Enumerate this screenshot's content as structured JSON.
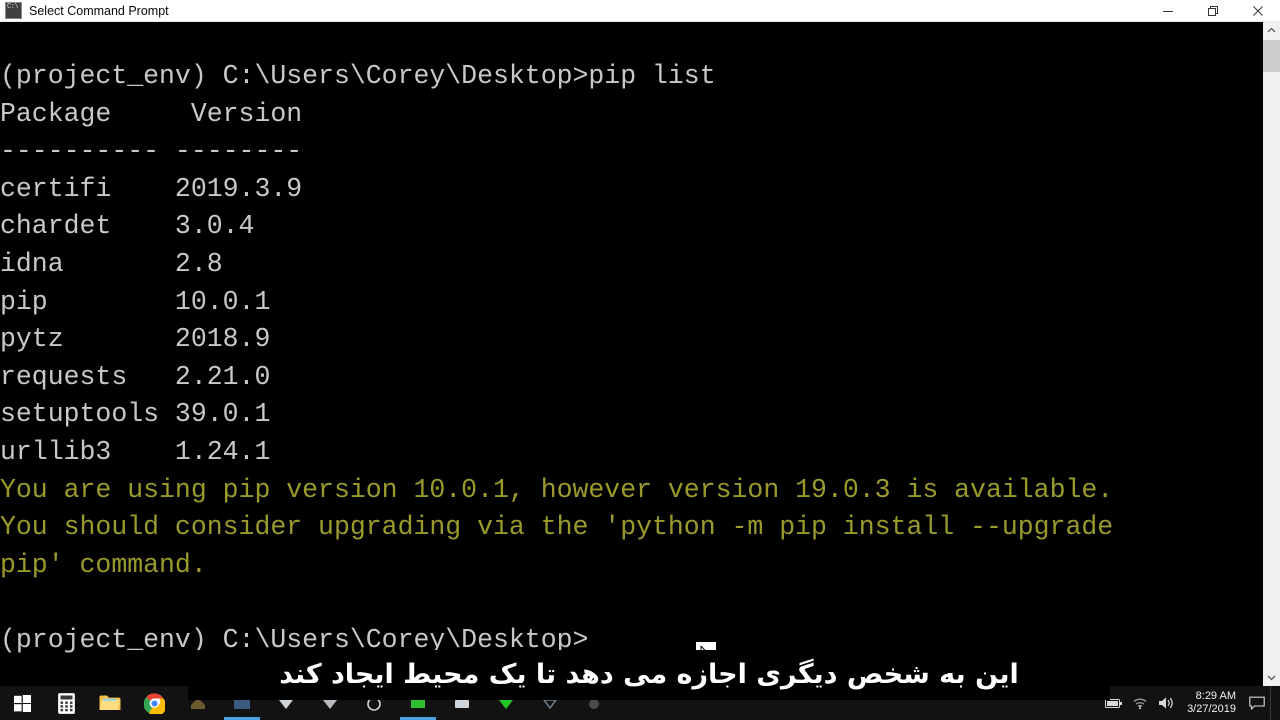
{
  "window": {
    "title": "Select Command Prompt",
    "icon": "command-prompt-icon",
    "controls": {
      "minimize": "minimize-icon",
      "restore": "restore-icon",
      "close": "close-icon"
    }
  },
  "console": {
    "background": "#000000",
    "foreground": "#c8c8c8",
    "warning_color": "#9a9a2c",
    "lines": [
      {
        "text": "(project_env) C:\\Users\\Corey\\Desktop>pip list",
        "style": "normal"
      },
      {
        "text": "Package     Version",
        "style": "normal"
      },
      {
        "text": "---------- --------",
        "style": "normal"
      },
      {
        "text": "certifi    2019.3.9",
        "style": "normal"
      },
      {
        "text": "chardet    3.0.4",
        "style": "normal"
      },
      {
        "text": "idna       2.8",
        "style": "normal"
      },
      {
        "text": "pip        10.0.1",
        "style": "normal"
      },
      {
        "text": "pytz       2018.9",
        "style": "normal"
      },
      {
        "text": "requests   2.21.0",
        "style": "normal"
      },
      {
        "text": "setuptools 39.0.1",
        "style": "normal"
      },
      {
        "text": "urllib3    1.24.1",
        "style": "normal"
      },
      {
        "text": "You are using pip version 10.0.1, however version 19.0.3 is available.",
        "style": "warn"
      },
      {
        "text": "You should consider upgrading via the 'python -m pip install --upgrade",
        "style": "warn"
      },
      {
        "text": "pip' command.",
        "style": "warn"
      },
      {
        "text": "",
        "style": "normal"
      },
      {
        "text": "(project_env) C:\\Users\\Corey\\Desktop>",
        "style": "normal"
      }
    ]
  },
  "subtitle": {
    "text": "این به شخص دیگری اجازه می دهد تا یک محیط ایجاد کند"
  },
  "taskbar": {
    "items": [
      {
        "name": "start-button",
        "icon": "windows-logo-icon",
        "active": false
      },
      {
        "name": "calculator",
        "icon": "calculator-icon",
        "active": false
      },
      {
        "name": "file-explorer",
        "icon": "folder-icon",
        "active": false
      },
      {
        "name": "google-chrome",
        "icon": "chrome-icon",
        "active": false
      },
      {
        "name": "app-5",
        "icon": "app-icon",
        "active": false
      },
      {
        "name": "app-6",
        "icon": "app-icon",
        "active": true
      },
      {
        "name": "app-7",
        "icon": "app-icon",
        "active": false
      },
      {
        "name": "app-8",
        "icon": "app-icon",
        "active": false
      },
      {
        "name": "app-9",
        "icon": "app-icon",
        "active": false
      },
      {
        "name": "app-10",
        "icon": "app-icon",
        "active": true
      },
      {
        "name": "app-11",
        "icon": "app-icon",
        "active": false
      },
      {
        "name": "app-12",
        "icon": "app-icon",
        "active": false
      },
      {
        "name": "app-13",
        "icon": "app-icon",
        "active": false
      },
      {
        "name": "app-14",
        "icon": "app-icon",
        "active": false
      }
    ],
    "tray": {
      "battery": "battery-icon",
      "network": "wifi-icon",
      "volume": "speaker-icon",
      "time": "8:29 AM",
      "date": "3/27/2019",
      "notifications": "action-center-icon"
    }
  },
  "scrollbar": {
    "up": "chevron-up-icon",
    "down": "chevron-down-icon"
  }
}
